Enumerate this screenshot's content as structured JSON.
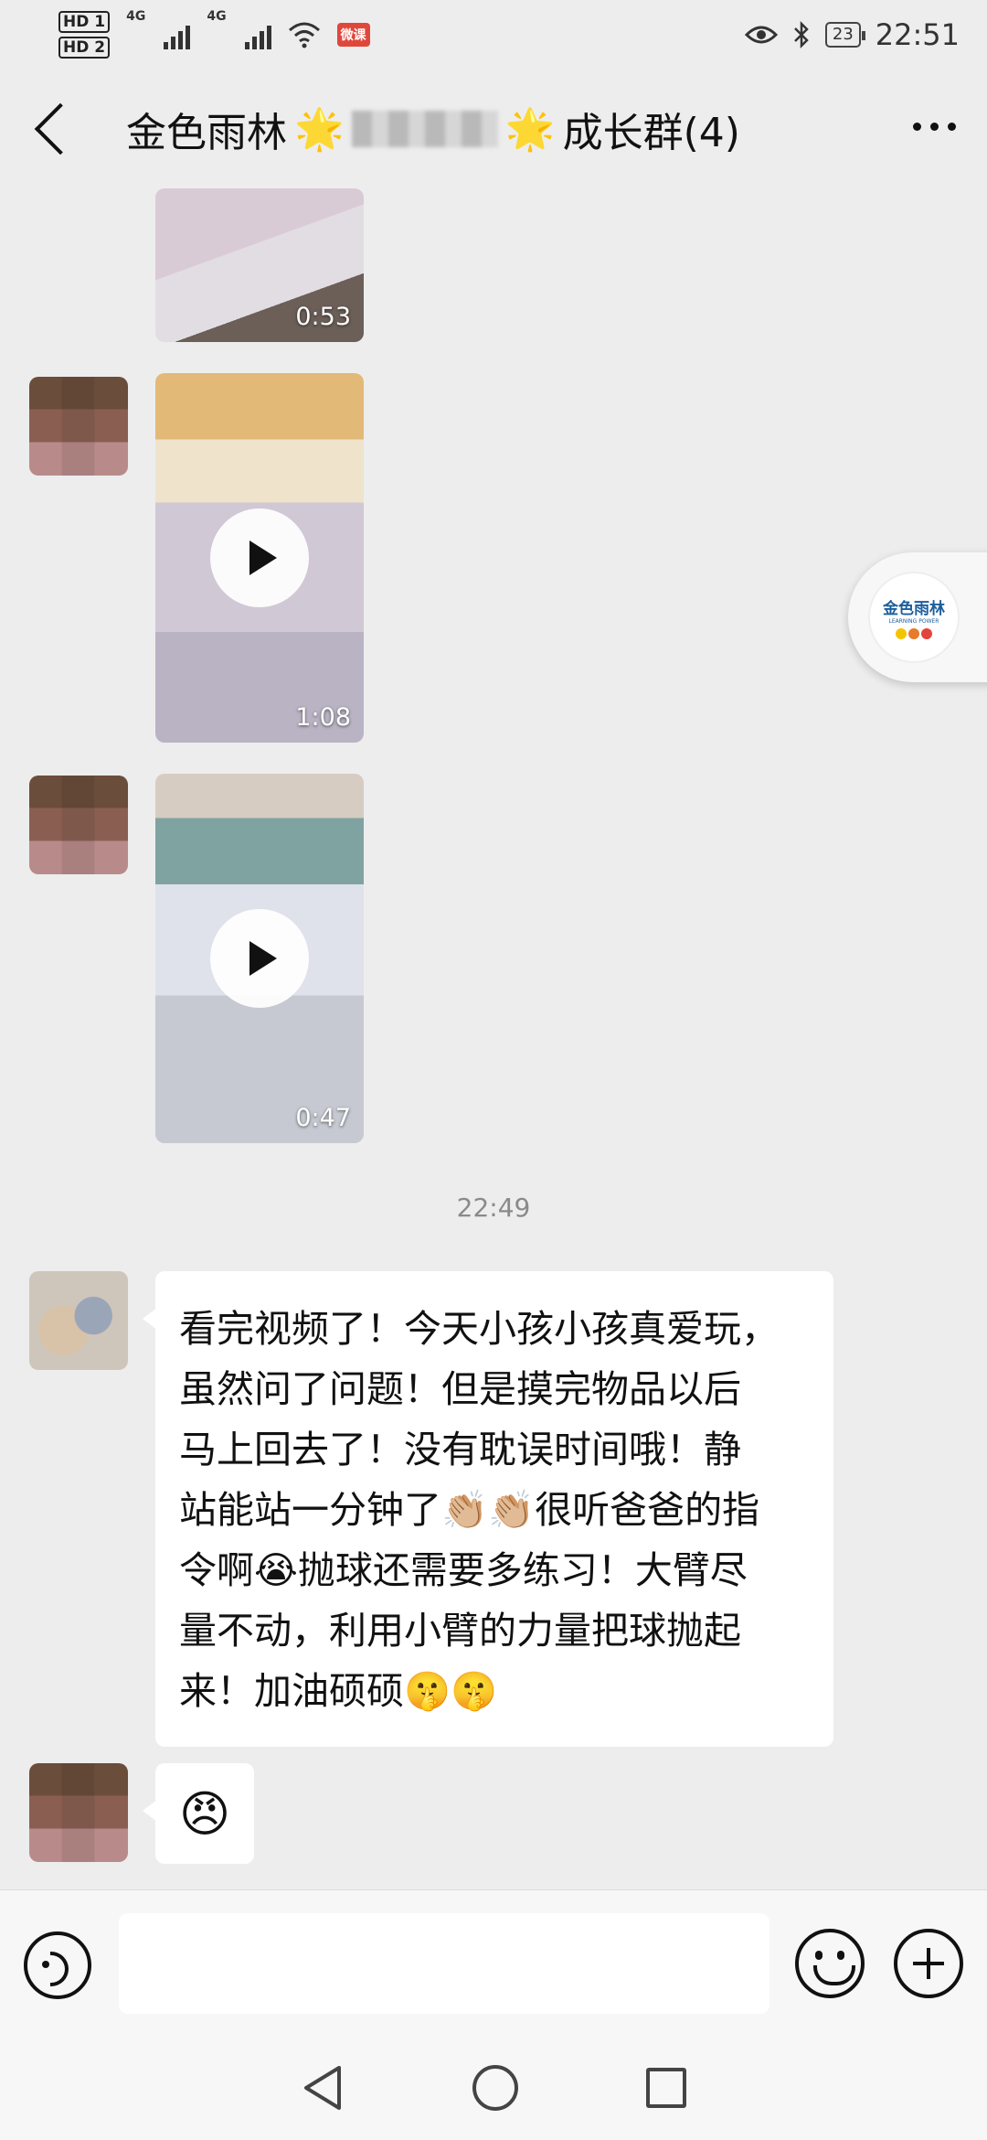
{
  "status_bar": {
    "hd1": "HD 1",
    "hd2": "HD 2",
    "net1": "4G",
    "net2": "4G",
    "app_badge": "微课",
    "battery": "23",
    "time": "22:51"
  },
  "header": {
    "title_prefix": "金色雨林",
    "title_suffix": "成长群(4)",
    "star_icon": "star-emoji"
  },
  "messages": [
    {
      "type": "video",
      "duration": "0:53"
    },
    {
      "type": "video",
      "duration": "1:08"
    },
    {
      "type": "video",
      "duration": "0:47"
    },
    {
      "type": "timestamp",
      "text": "22:49"
    },
    {
      "type": "text",
      "text": "看完视频了！今天小孩小孩真爱玩，\n虽然问了问题！但是摸完物品以后\n马上回去了！没有耽误时间哦！静\n站能站一分钟了👏🏼👏🏼很听爸爸的指\n令啊😭抛球还需要多练习！大臂尽\n量不动，利用小臂的力量把球抛起\n来！加油硕硕🤫🤫"
    },
    {
      "type": "emoji",
      "text": "😠"
    }
  ],
  "floating_widget": {
    "brand": "金色雨林",
    "subtitle": "LEARNING POWER",
    "colors": [
      "#f4c400",
      "#e87a2c",
      "#e2453c"
    ]
  },
  "input_bar": {
    "placeholder": ""
  }
}
